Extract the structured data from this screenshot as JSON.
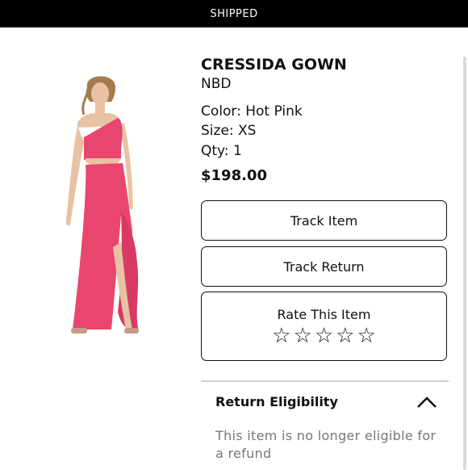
{
  "status_bar": {
    "label": "SHIPPED"
  },
  "product": {
    "name": "CRESSIDA GOWN",
    "brand": "NBD",
    "color": "Color: Hot Pink",
    "size": "Size: XS",
    "qty": "Qty: 1",
    "price": "$198.00",
    "image_icon": "dress-photo",
    "accent_color": "#e8466e"
  },
  "actions": {
    "track_item": "Track Item",
    "track_return": "Track Return",
    "rate_item": "Rate This Item",
    "rating": {
      "value": 0,
      "max": 5,
      "icon": "star-outline-icon"
    }
  },
  "eligibility": {
    "title": "Return Eligibility",
    "message": "This item is no longer eligible for a refund",
    "toggle_icon": "chevron-up-icon"
  }
}
